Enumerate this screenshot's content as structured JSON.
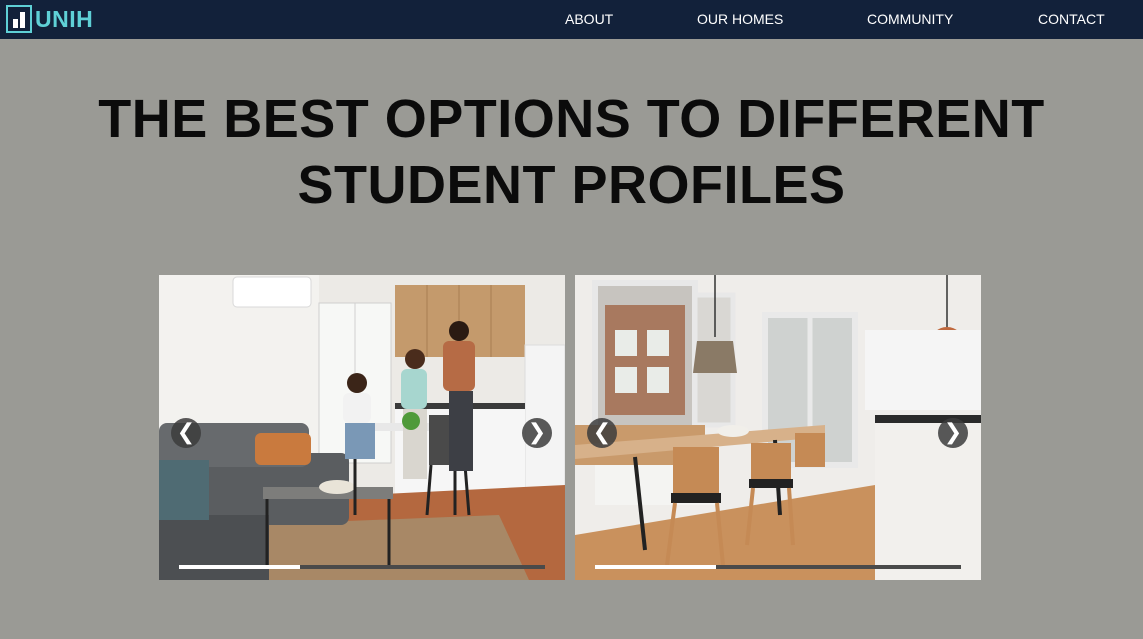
{
  "brand": {
    "name": "UNIH",
    "accent_color": "#5fd0d6",
    "header_color": "#12213a"
  },
  "nav": {
    "items": [
      {
        "label": "ABOUT"
      },
      {
        "label": "OUR HOMES"
      },
      {
        "label": "COMMUNITY"
      },
      {
        "label": "CONTACT"
      }
    ]
  },
  "hero": {
    "title_line1": "THE BEST OPTIONS TO DIFFERENT",
    "title_line2": "STUDENT PROFILES"
  },
  "carousels": [
    {
      "photo_subject": "students-cooking-in-shared-kitchen-living-room",
      "prev_icon": "chevron-left-icon",
      "next_icon": "chevron-right-icon",
      "prev_glyph": "❮",
      "next_glyph": "❯",
      "progress": 0.33
    },
    {
      "photo_subject": "dining-table-and-kitchen",
      "prev_icon": "chevron-left-icon",
      "next_icon": "chevron-right-icon",
      "prev_glyph": "❮",
      "next_glyph": "❯",
      "progress": 0.33
    }
  ],
  "page_background": "#9a9a95"
}
